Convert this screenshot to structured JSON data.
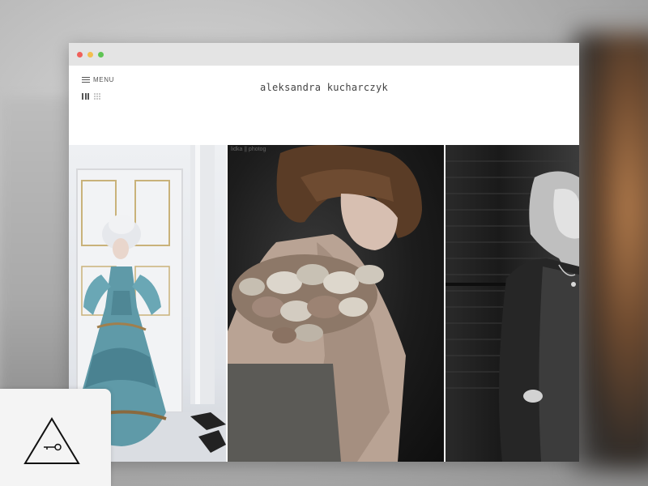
{
  "site": {
    "title": "aleksandra kucharczyk"
  },
  "header": {
    "menu_label": "MENU"
  },
  "photo_watermark": "lidka || photog",
  "colors": {
    "close_dot": "#f0605b",
    "minimize_dot": "#f3be4f",
    "zoom_dot": "#5fc454",
    "text": "#444444"
  },
  "icons": {
    "menu": "hamburger-icon",
    "view_columns": "columns-view-icon",
    "view_grid": "grid-view-icon",
    "badge": "triangle-key-icon"
  }
}
